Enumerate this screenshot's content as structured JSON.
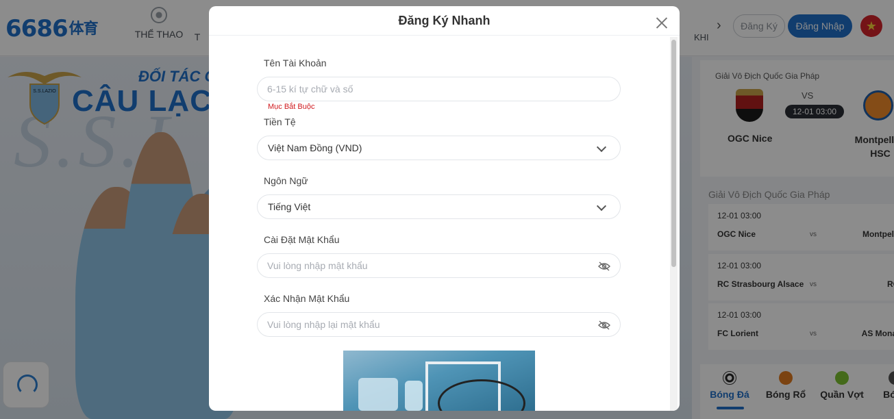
{
  "site": {
    "logo_text": "6686",
    "logo_suffix": "体育",
    "nav": {
      "sports_label": "THỂ THAO",
      "partial_label": "T",
      "khu_label": "KHI"
    },
    "register_button": "Đăng Ký",
    "login_button": "Đăng Nhập",
    "flag_icon": "vietnam-flag-icon"
  },
  "banner": {
    "club_logo_text": "S.S.LAZIO",
    "partner_line": "ĐỐI TÁC C",
    "club_line": "CÂU LẠC",
    "watermark": "S.S.L"
  },
  "featured_match": {
    "league": "Giải Vô Địch Quốc Gia Pháp",
    "vs": "VS",
    "time": "12-01 03:00",
    "home": "OGC Nice",
    "away": "Montpellier HSC"
  },
  "match_list": {
    "title": "Giải Vô Địch Quốc Gia Pháp",
    "rows": [
      {
        "time": "12-01  03:00",
        "home": "OGC Nice",
        "vs": "vs",
        "away": "Montpellier"
      },
      {
        "time": "12-01  03:00",
        "home": "RC Strasbourg Alsace",
        "vs": "vs",
        "away": "RC L"
      },
      {
        "time": "12-01  03:00",
        "home": "FC Lorient",
        "vs": "vs",
        "away": "AS Monaco"
      }
    ]
  },
  "sports_tabs": [
    "Bóng Đá",
    "Bóng Rổ",
    "Quần Vợt",
    "Bóng"
  ],
  "modal": {
    "title": "Đăng Ký Nhanh",
    "username": {
      "label": "Tên Tài Khoản",
      "placeholder": "6-15 kí tự chữ và số",
      "error": "Mục Bắt Buộc"
    },
    "currency": {
      "label": "Tiền Tệ",
      "value": "Việt Nam Đồng (VND)"
    },
    "language": {
      "label": "Ngôn Ngữ",
      "value": "Tiếng Việt"
    },
    "password": {
      "label": "Cài Đặt Mật Khẩu",
      "placeholder": "Vui lòng nhập mật khẩu"
    },
    "confirm_password": {
      "label": "Xác Nhận Mật Khẩu",
      "placeholder": "Vui lòng nhập lại mật khẩu"
    }
  },
  "colors": {
    "brand_blue": "#1f6fc8",
    "error_red": "#d0191e",
    "overlay": "rgba(0,0,0,0.45)"
  }
}
